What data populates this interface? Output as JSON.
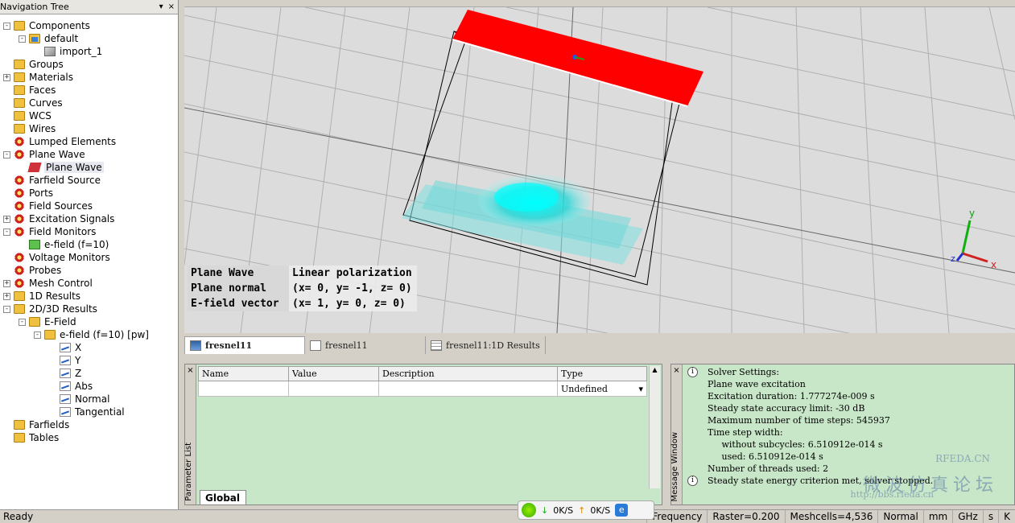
{
  "nav": {
    "title": "Navigation Tree",
    "buttons": [
      "▾",
      "×"
    ],
    "items": [
      {
        "label": "Components",
        "depth": 0,
        "exp": "-",
        "icon": "folder"
      },
      {
        "label": "default",
        "depth": 1,
        "exp": "-",
        "icon": "folder-blue"
      },
      {
        "label": "import_1",
        "depth": 2,
        "exp": "",
        "icon": "cube"
      },
      {
        "label": "Groups",
        "depth": 0,
        "exp": "",
        "icon": "folder"
      },
      {
        "label": "Materials",
        "depth": 0,
        "exp": "+",
        "icon": "folder"
      },
      {
        "label": "Faces",
        "depth": 0,
        "exp": "",
        "icon": "folder"
      },
      {
        "label": "Curves",
        "depth": 0,
        "exp": "",
        "icon": "folder"
      },
      {
        "label": "WCS",
        "depth": 0,
        "exp": "",
        "icon": "folder"
      },
      {
        "label": "Wires",
        "depth": 0,
        "exp": "",
        "icon": "folder"
      },
      {
        "label": "Lumped Elements",
        "depth": 0,
        "exp": "",
        "icon": "gear"
      },
      {
        "label": "Plane Wave",
        "depth": 0,
        "exp": "-",
        "icon": "gear"
      },
      {
        "label": "Plane Wave",
        "depth": 1,
        "exp": "",
        "icon": "wave",
        "hl": true
      },
      {
        "label": "Farfield Source",
        "depth": 0,
        "exp": "",
        "icon": "gear"
      },
      {
        "label": "Ports",
        "depth": 0,
        "exp": "",
        "icon": "gear"
      },
      {
        "label": "Field Sources",
        "depth": 0,
        "exp": "",
        "icon": "gear"
      },
      {
        "label": "Excitation Signals",
        "depth": 0,
        "exp": "+",
        "icon": "gear"
      },
      {
        "label": "Field Monitors",
        "depth": 0,
        "exp": "-",
        "icon": "gear"
      },
      {
        "label": "e-field (f=10)",
        "depth": 1,
        "exp": "",
        "icon": "mon"
      },
      {
        "label": "Voltage Monitors",
        "depth": 0,
        "exp": "",
        "icon": "gear"
      },
      {
        "label": "Probes",
        "depth": 0,
        "exp": "",
        "icon": "gear"
      },
      {
        "label": "Mesh Control",
        "depth": 0,
        "exp": "+",
        "icon": "gear"
      },
      {
        "label": "1D Results",
        "depth": 0,
        "exp": "+",
        "icon": "folder"
      },
      {
        "label": "2D/3D Results",
        "depth": 0,
        "exp": "-",
        "icon": "folder"
      },
      {
        "label": "E-Field",
        "depth": 1,
        "exp": "-",
        "icon": "folder"
      },
      {
        "label": "e-field (f=10) [pw]",
        "depth": 2,
        "exp": "-",
        "icon": "folder"
      },
      {
        "label": "X",
        "depth": 3,
        "exp": "",
        "icon": "chart"
      },
      {
        "label": "Y",
        "depth": 3,
        "exp": "",
        "icon": "chart"
      },
      {
        "label": "Z",
        "depth": 3,
        "exp": "",
        "icon": "chart"
      },
      {
        "label": "Abs",
        "depth": 3,
        "exp": "",
        "icon": "chart"
      },
      {
        "label": "Normal",
        "depth": 3,
        "exp": "",
        "icon": "chart"
      },
      {
        "label": "Tangential",
        "depth": 3,
        "exp": "",
        "icon": "chart"
      },
      {
        "label": "Farfields",
        "depth": 0,
        "exp": "",
        "icon": "folder"
      },
      {
        "label": "Tables",
        "depth": 0,
        "exp": "",
        "icon": "folder"
      }
    ]
  },
  "viewport": {
    "info": [
      {
        "key": "Plane Wave",
        "value": "Linear polarization"
      },
      {
        "key": "Plane normal",
        "value": "(x= 0, y= -1, z= 0)"
      },
      {
        "key": "E-field vector",
        "value": "(x= 1, y= 0, z= 0)"
      }
    ],
    "axes": {
      "y": "y",
      "z": "z",
      "x": "x"
    }
  },
  "tabs": [
    {
      "label": "fresnel11",
      "icon": "wave",
      "active": true
    },
    {
      "label": "fresnel11",
      "icon": "win",
      "active": false
    },
    {
      "label": "fresnel11:1D Results",
      "icon": "grid",
      "active": false
    }
  ],
  "params": {
    "side_label": "Parameter List",
    "close": "×",
    "columns": [
      "Name",
      "Value",
      "Description",
      "Type"
    ],
    "row": {
      "name": "",
      "value": "",
      "description": "",
      "type": "Undefined"
    },
    "global_tab": "Global"
  },
  "messages": {
    "side_label": "Message Window",
    "close": "×",
    "entries": [
      {
        "icon": "i",
        "lines": [
          "Solver Settings:",
          "Plane wave excitation",
          "Excitation duration: 1.777274e-009 s",
          "Steady state accuracy limit: -30 dB",
          "Maximum number of time steps: 545937",
          "Time step width:",
          "     without subcycles: 6.510912e-014 s",
          "     used: 6.510912e-014 s",
          "Number of threads used: 2"
        ]
      },
      {
        "icon": "i",
        "lines": [
          "Steady state energy criterion met, solver stopped."
        ]
      }
    ],
    "watermark": {
      "main": "微波仿真论坛",
      "site": "RFEDA.CN",
      "url": "http://bbs.rfeda.cn"
    }
  },
  "netmon": {
    "down": "0K/S",
    "up": "0K/S"
  },
  "status": {
    "left": "Ready",
    "cells": [
      "Frequency",
      "Raster=0.200",
      "Meshcells=4,536",
      "Normal",
      "mm",
      "GHz",
      "s",
      "K"
    ]
  },
  "colors": {
    "accent_red": "#ff0000",
    "field_cyan": "#00e5e5",
    "panel_green": "#c8e6c8"
  }
}
